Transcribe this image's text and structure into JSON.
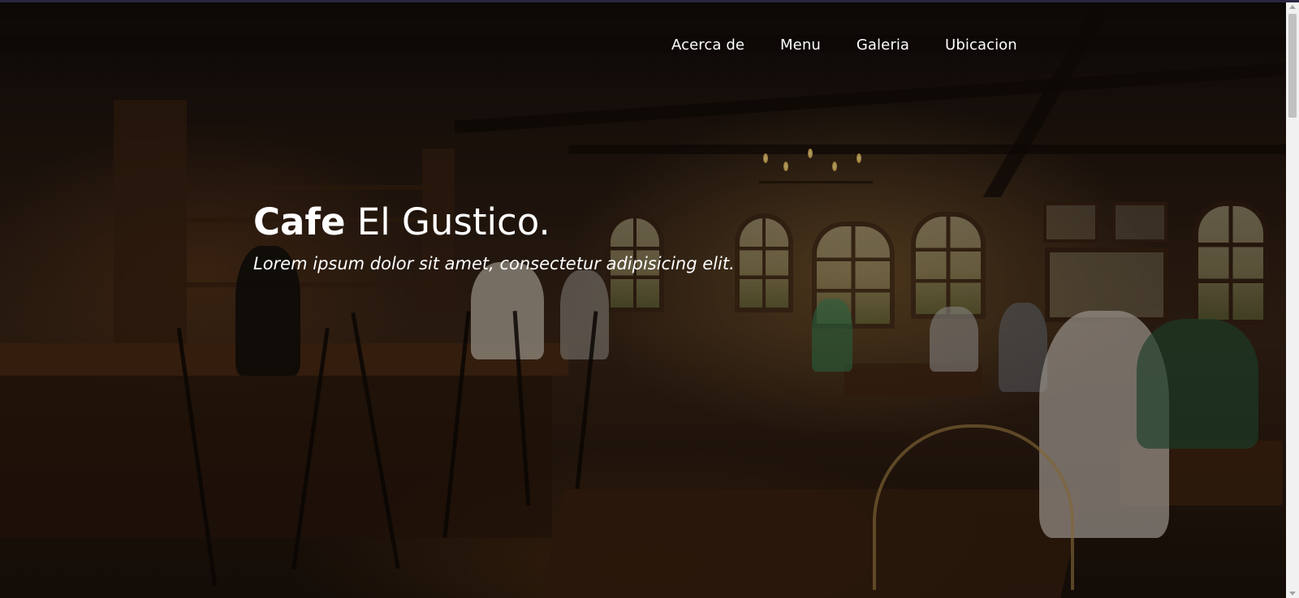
{
  "nav": {
    "items": [
      {
        "label": "Acerca de"
      },
      {
        "label": "Menu"
      },
      {
        "label": "Galeria"
      },
      {
        "label": "Ubicacion"
      }
    ]
  },
  "hero": {
    "title_bold": "Cafe",
    "title_rest": " El Gustico.",
    "subtitle": "Lorem ipsum dolor sit amet, consectetur adipisicing elit.",
    "background_image": "cafe-interior-photo"
  },
  "colors": {
    "text": "#ffffff",
    "top_line": "#2b2740",
    "scrollbar_track": "#f1f1f1",
    "scrollbar_thumb": "#c1c1c1"
  }
}
